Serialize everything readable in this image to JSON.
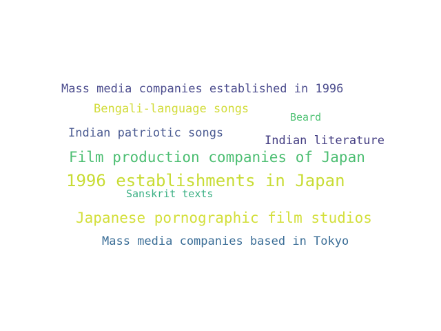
{
  "words": [
    {
      "text": "Mass media companies established in 1996",
      "color": "#4e4f8f"
    },
    {
      "text": "Bengali-language songs",
      "color": "#d2dc3a"
    },
    {
      "text": "Beard",
      "color": "#4fc274"
    },
    {
      "text": "Indian patriotic songs",
      "color": "#4a5a91"
    },
    {
      "text": "Indian literature",
      "color": "#433d82"
    },
    {
      "text": "Film production companies of Japan",
      "color": "#4cbe72"
    },
    {
      "text": "1996 establishments in Japan",
      "color": "#c8dc34"
    },
    {
      "text": "Sanskrit texts",
      "color": "#3bb084"
    },
    {
      "text": "Japanese pornographic film studios",
      "color": "#d3df3b"
    },
    {
      "text": "Mass media companies based in Tokyo",
      "color": "#3a6d96"
    }
  ]
}
